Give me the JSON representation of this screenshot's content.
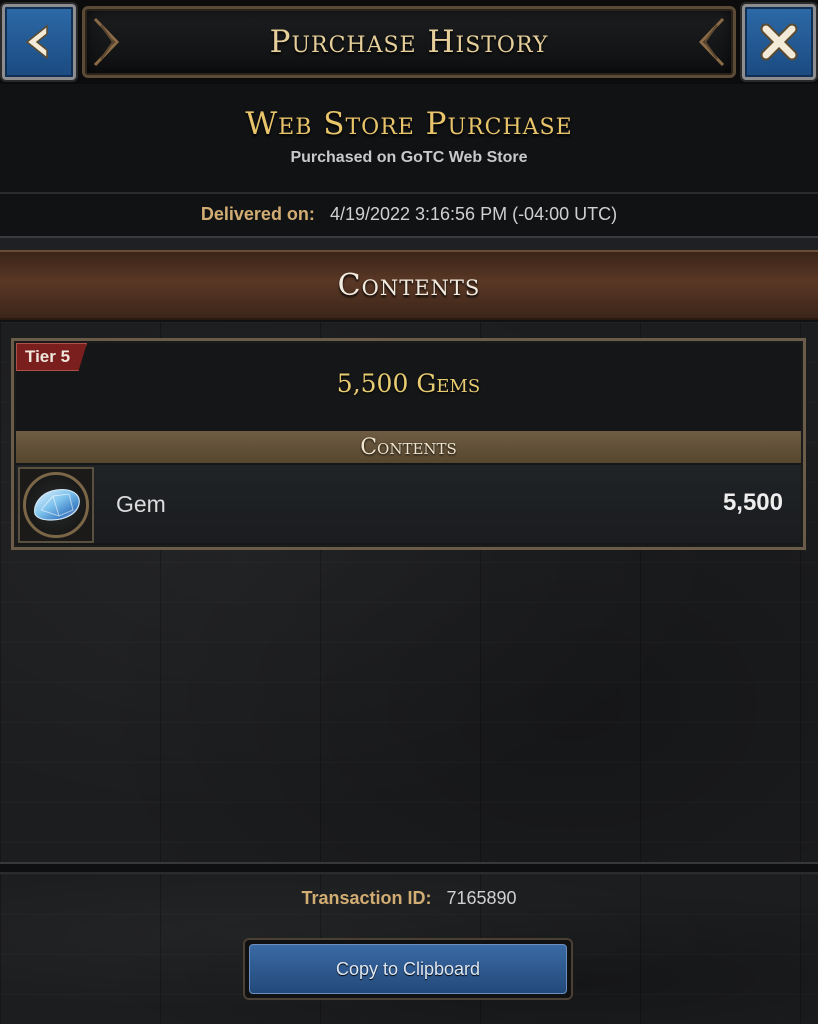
{
  "header": {
    "title": "Purchase History",
    "back_icon": "arrow-left-icon",
    "close_icon": "close-x-icon"
  },
  "purchase": {
    "type": "Web Store Purchase",
    "source": "Purchased on GoTC Web Store",
    "delivered_label": "Delivered on:",
    "delivered_value": "4/19/2022 3:16:56 PM (-04:00 UTC)"
  },
  "contents_heading": "Contents",
  "bundle": {
    "tier_label": "Tier 5",
    "name": "5,500 Gems",
    "contents_heading": "Contents",
    "items": [
      {
        "icon": "gem-icon",
        "name": "Gem",
        "quantity": "5,500"
      }
    ]
  },
  "footer": {
    "transaction_label": "Transaction ID:",
    "transaction_value": "7165890",
    "copy_button_label": "Copy to Clipboard"
  },
  "colors": {
    "button_blue": "#2c6aa8",
    "title_gold": "#e6cf9a",
    "accent_gold": "#e8c46a",
    "label_tan": "#d2ad73",
    "tier_red": "#7a1f1d",
    "banner_brown": "#5a3826"
  }
}
